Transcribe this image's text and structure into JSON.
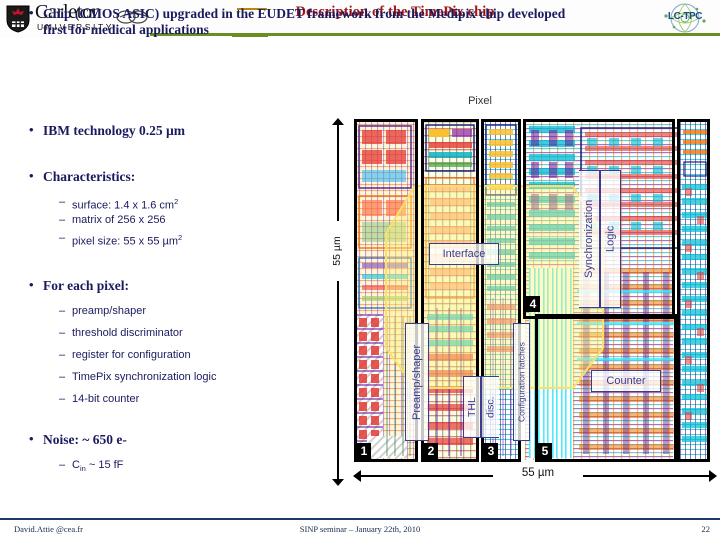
{
  "header": {
    "title": "Description of the TimePix chip",
    "title_color": "#a01818",
    "rule_color": "#6b8e23",
    "left_logo": {
      "name": "Carleton",
      "subtitle": "UNIVERSITY",
      "partner_logo": "cea"
    },
    "right_logo": {
      "text": "LC-TPC"
    }
  },
  "body": {
    "bullets": [
      {
        "id": "chip",
        "line1": "Chip (CMOS ASIC) upgraded in the EUDET framework from the Medipix chip developed",
        "line2": "first for medical applications"
      },
      {
        "id": "ibm",
        "line1": "IBM technology 0.25 µm"
      },
      {
        "id": "characteristics",
        "line1": "Characteristics:"
      },
      {
        "id": "foreachpixel",
        "line1": "For each pixel:"
      },
      {
        "id": "noise",
        "line1": "Noise: ~ 650 e-"
      }
    ],
    "characteristics_items": [
      {
        "prefix": "surface: 1.4 x 1.6 cm",
        "sup": "2"
      },
      {
        "prefix": "matrix of 256 x 256",
        "sup": ""
      },
      {
        "prefix": "pixel size: 55 x 55 µm",
        "sup": "2"
      }
    ],
    "pixel_items": [
      "preamp/shaper",
      "threshold discriminator",
      "register for configuration",
      "TimePix synchronization logic",
      "14-bit counter"
    ],
    "noise_items": [
      {
        "pre": "C",
        "sub": "in",
        "post": " ~ 15 fF"
      }
    ],
    "bullet_glyph": "•",
    "dash_glyph": "–"
  },
  "figure": {
    "caption": "Pixel",
    "vertical_axis_label": "55 µm",
    "horizontal_axis_label": "55 µm",
    "blocks": [
      {
        "id": "preamp",
        "label": "Preamp/shaper",
        "orientation": "vertical"
      },
      {
        "id": "thl",
        "label": "THL",
        "orientation": "vertical"
      },
      {
        "id": "disc",
        "label": "disc.",
        "orientation": "vertical"
      },
      {
        "id": "config",
        "label": "Configuration latches",
        "orientation": "vertical"
      },
      {
        "id": "sync",
        "label": "Synchronization",
        "orientation": "vertical"
      },
      {
        "id": "synclogic",
        "label": "Logic",
        "orientation": "vertical"
      },
      {
        "id": "counter",
        "label": "Counter",
        "orientation": "horizontal"
      },
      {
        "id": "interface",
        "label": "Interface",
        "orientation": "horizontal"
      }
    ],
    "region_indices": [
      "1",
      "2",
      "3",
      "4",
      "5"
    ],
    "highlight_color": "#fffac0"
  },
  "footer": {
    "left": "David.Attie @cea.fr",
    "center": "SINP seminar – January 22th, 2010",
    "page": "22",
    "rule_color": "#1a3a6b"
  }
}
